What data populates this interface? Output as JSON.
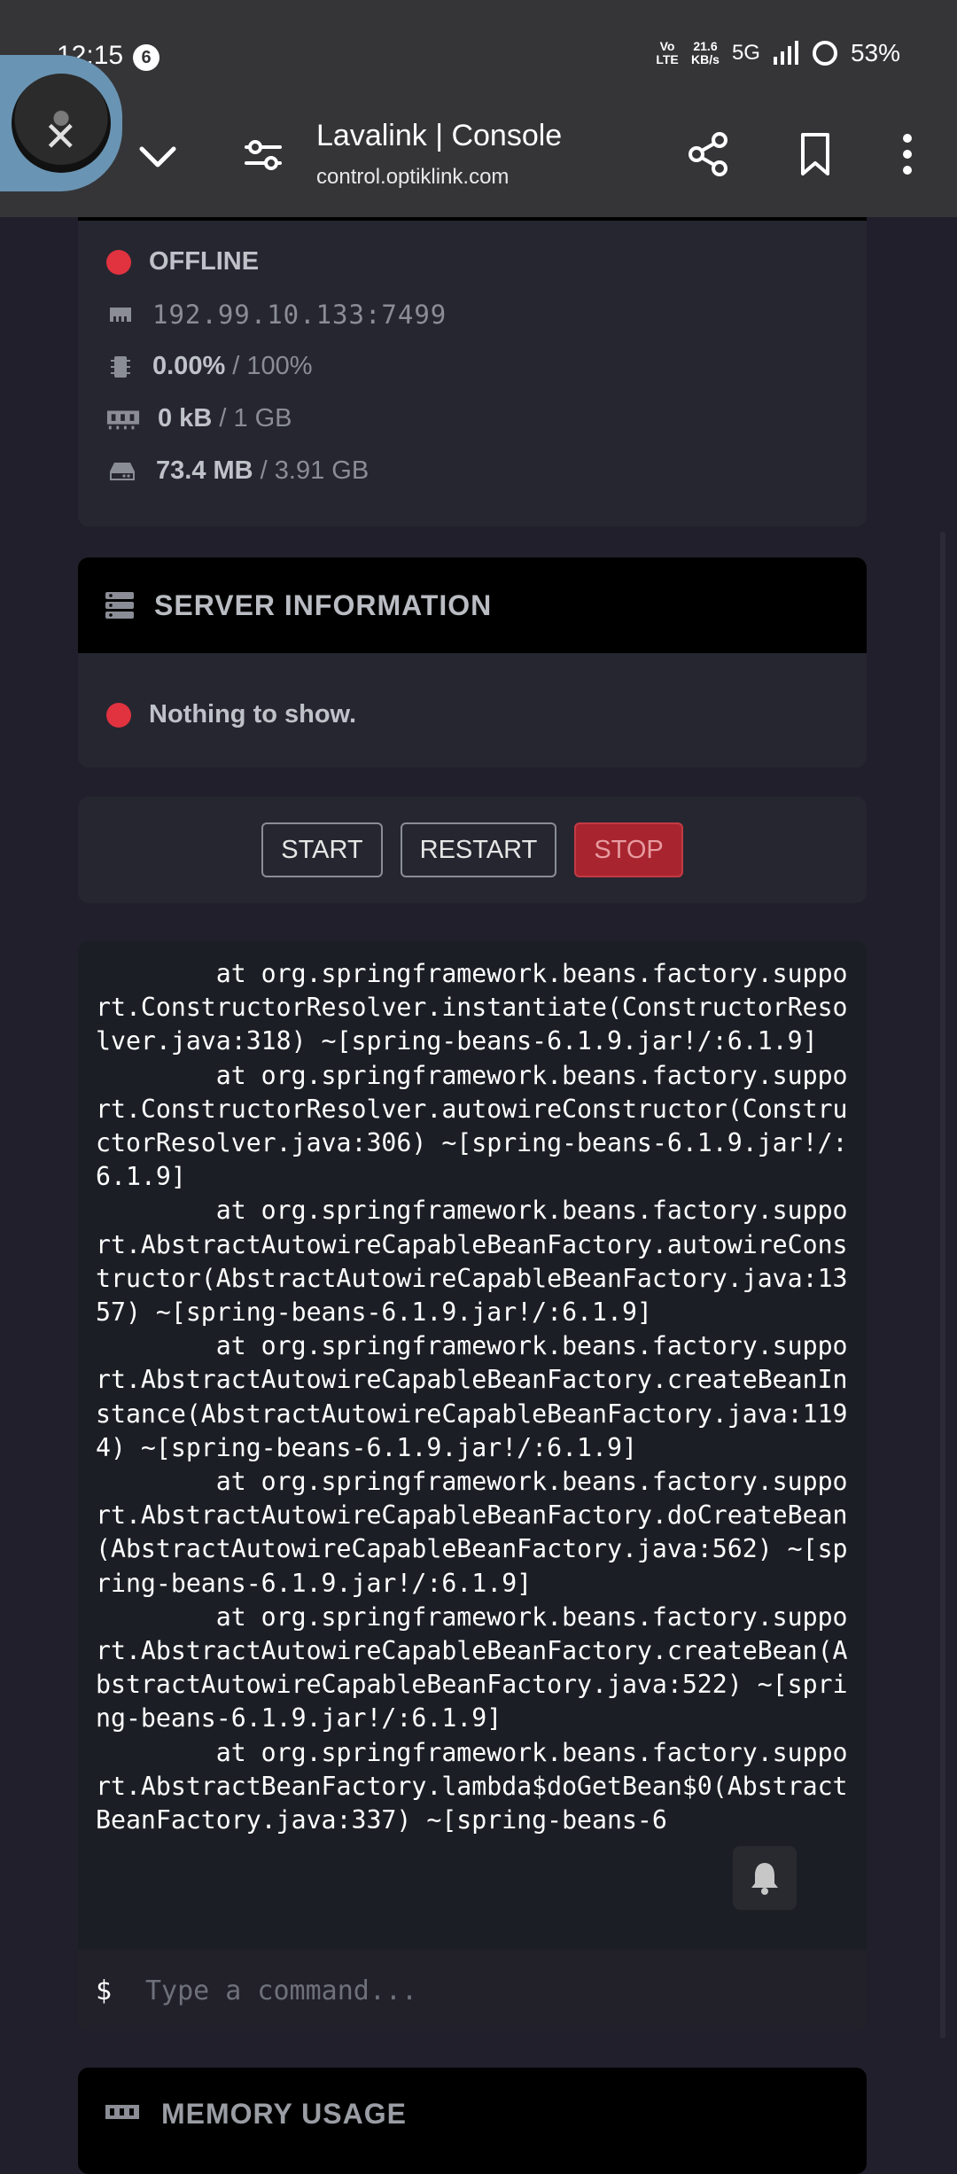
{
  "status_bar": {
    "time": "12:15",
    "notification_count": "6",
    "network_speed_value": "21.6",
    "network_speed_unit": "KB/s",
    "volte_label": "Vo LTE",
    "network_type": "5G",
    "battery": "53%"
  },
  "browser": {
    "title": "Lavalink | Console",
    "url": "control.optiklink.com"
  },
  "server_status": {
    "state": "OFFLINE",
    "address": "192.99.10.133:7499",
    "cpu_used": "0.00%",
    "cpu_limit": "/ 100%",
    "memory_used": "0 kB",
    "memory_limit": "/ 1 GB",
    "disk_used": "73.4 MB",
    "disk_limit": "/ 3.91 GB"
  },
  "server_information": {
    "title": "SERVER INFORMATION",
    "empty_text": "Nothing to show."
  },
  "controls": {
    "start_label": "START",
    "restart_label": "RESTART",
    "stop_label": "STOP"
  },
  "console": {
    "output": "        at org.springframework.beans.factory.support.ConstructorResolver.instantiate(ConstructorResolver.java:318) ~[spring-beans-6.1.9.jar!/:6.1.9]\n        at org.springframework.beans.factory.support.ConstructorResolver.autowireConstructor(ConstructorResolver.java:306) ~[spring-beans-6.1.9.jar!/:6.1.9]\n        at org.springframework.beans.factory.support.AbstractAutowireCapableBeanFactory.autowireConstructor(AbstractAutowireCapableBeanFactory.java:1357) ~[spring-beans-6.1.9.jar!/:6.1.9]\n        at org.springframework.beans.factory.support.AbstractAutowireCapableBeanFactory.createBeanInstance(AbstractAutowireCapableBeanFactory.java:1194) ~[spring-beans-6.1.9.jar!/:6.1.9]\n        at org.springframework.beans.factory.support.AbstractAutowireCapableBeanFactory.doCreateBean(AbstractAutowireCapableBeanFactory.java:562) ~[spring-beans-6.1.9.jar!/:6.1.9]\n        at org.springframework.beans.factory.support.AbstractAutowireCapableBeanFactory.createBean(AbstractAutowireCapableBeanFactory.java:522) ~[spring-beans-6.1.9.jar!/:6.1.9]\n        at org.springframework.beans.factory.support.AbstractBeanFactory.lambda$doGetBean$0(AbstractBeanFactory.java:337) ~[spring-beans-6",
    "prompt_symbol": "$",
    "input_placeholder": "Type a command..."
  },
  "memory_usage": {
    "title": "MEMORY USAGE"
  },
  "colors": {
    "page_bg": "#201f2b",
    "card_bg": "#262630",
    "offline_red": "#e0323f",
    "stop_button": "#a8252f",
    "console_bg": "#1b1f25"
  },
  "icons": {
    "status": "status-dot-icon",
    "address": "ethernet-icon",
    "cpu": "microchip-icon",
    "memory": "memory-icon",
    "disk": "hard-drive-icon",
    "server_info": "server-icon",
    "notifications": "bell-icon"
  }
}
